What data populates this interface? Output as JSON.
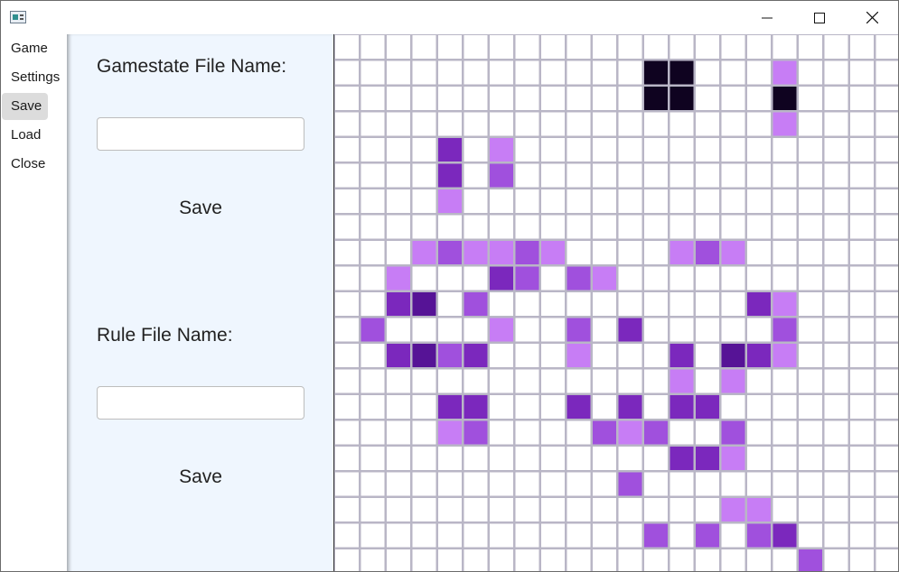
{
  "window": {
    "title": "",
    "controls": [
      "minimize",
      "maximize",
      "close"
    ]
  },
  "menu": {
    "items": [
      {
        "label": "Game",
        "selected": false
      },
      {
        "label": "Settings",
        "selected": false
      },
      {
        "label": "Save",
        "selected": true
      },
      {
        "label": "Load",
        "selected": false
      },
      {
        "label": "Close",
        "selected": false
      }
    ]
  },
  "save_panel": {
    "gamestate_label": "Gamestate File Name:",
    "gamestate_value": "",
    "gamestate_button": "Save",
    "rule_label": "Rule File Name:",
    "rule_value": "",
    "rule_button": "Save"
  },
  "grid": {
    "columns": 22,
    "rows": 21,
    "colors": {
      "0": "#ffffff",
      "1": "#c77df5",
      "2": "#a050dd",
      "3": "#7b28bd",
      "4": "#561396",
      "5": "#0f0320"
    },
    "cells": [
      [
        0,
        0,
        0,
        0,
        0,
        0,
        0,
        0,
        0,
        0,
        0,
        0,
        0,
        0,
        0,
        0,
        0,
        0,
        0,
        0,
        0,
        0
      ],
      [
        0,
        0,
        0,
        0,
        0,
        0,
        0,
        0,
        0,
        0,
        0,
        0,
        5,
        5,
        0,
        0,
        0,
        1,
        0,
        0,
        0,
        0
      ],
      [
        0,
        0,
        0,
        0,
        0,
        0,
        0,
        0,
        0,
        0,
        0,
        0,
        5,
        5,
        0,
        0,
        0,
        5,
        0,
        0,
        0,
        0
      ],
      [
        0,
        0,
        0,
        0,
        0,
        0,
        0,
        0,
        0,
        0,
        0,
        0,
        0,
        0,
        0,
        0,
        0,
        1,
        0,
        0,
        0,
        0
      ],
      [
        0,
        0,
        0,
        0,
        3,
        0,
        1,
        0,
        0,
        0,
        0,
        0,
        0,
        0,
        0,
        0,
        0,
        0,
        0,
        0,
        0,
        0
      ],
      [
        0,
        0,
        0,
        0,
        3,
        0,
        2,
        0,
        0,
        0,
        0,
        0,
        0,
        0,
        0,
        0,
        0,
        0,
        0,
        0,
        0,
        0
      ],
      [
        0,
        0,
        0,
        0,
        1,
        0,
        0,
        0,
        0,
        0,
        0,
        0,
        0,
        0,
        0,
        0,
        0,
        0,
        0,
        0,
        0,
        0
      ],
      [
        0,
        0,
        0,
        0,
        0,
        0,
        0,
        0,
        0,
        0,
        0,
        0,
        0,
        0,
        0,
        0,
        0,
        0,
        0,
        0,
        0,
        0
      ],
      [
        0,
        0,
        0,
        1,
        2,
        1,
        1,
        2,
        1,
        0,
        0,
        0,
        0,
        1,
        2,
        1,
        0,
        0,
        0,
        0,
        0,
        0
      ],
      [
        0,
        0,
        1,
        0,
        0,
        0,
        3,
        2,
        0,
        2,
        1,
        0,
        0,
        0,
        0,
        0,
        0,
        0,
        0,
        0,
        0,
        0
      ],
      [
        0,
        0,
        3,
        4,
        0,
        2,
        0,
        0,
        0,
        0,
        0,
        0,
        0,
        0,
        0,
        0,
        3,
        1,
        0,
        0,
        0,
        0
      ],
      [
        0,
        2,
        0,
        0,
        0,
        0,
        1,
        0,
        0,
        2,
        0,
        3,
        0,
        0,
        0,
        0,
        0,
        2,
        0,
        0,
        0,
        0
      ],
      [
        0,
        0,
        3,
        4,
        2,
        3,
        0,
        0,
        0,
        1,
        0,
        0,
        0,
        3,
        0,
        4,
        3,
        1,
        0,
        0,
        0,
        0
      ],
      [
        0,
        0,
        0,
        0,
        0,
        0,
        0,
        0,
        0,
        0,
        0,
        0,
        0,
        1,
        0,
        1,
        0,
        0,
        0,
        0,
        0,
        0
      ],
      [
        0,
        0,
        0,
        0,
        3,
        3,
        0,
        0,
        0,
        3,
        0,
        3,
        0,
        3,
        3,
        0,
        0,
        0,
        0,
        0,
        0,
        0
      ],
      [
        0,
        0,
        0,
        0,
        1,
        2,
        0,
        0,
        0,
        0,
        2,
        1,
        2,
        0,
        0,
        2,
        0,
        0,
        0,
        0,
        0,
        0
      ],
      [
        0,
        0,
        0,
        0,
        0,
        0,
        0,
        0,
        0,
        0,
        0,
        0,
        0,
        3,
        3,
        1,
        0,
        0,
        0,
        0,
        0,
        0
      ],
      [
        0,
        0,
        0,
        0,
        0,
        0,
        0,
        0,
        0,
        0,
        0,
        2,
        0,
        0,
        0,
        0,
        0,
        0,
        0,
        0,
        0,
        0
      ],
      [
        0,
        0,
        0,
        0,
        0,
        0,
        0,
        0,
        0,
        0,
        0,
        0,
        0,
        0,
        0,
        1,
        1,
        0,
        0,
        0,
        0,
        0
      ],
      [
        0,
        0,
        0,
        0,
        0,
        0,
        0,
        0,
        0,
        0,
        0,
        0,
        2,
        0,
        2,
        0,
        2,
        3,
        0,
        0,
        0,
        0
      ],
      [
        0,
        0,
        0,
        0,
        0,
        0,
        0,
        0,
        0,
        0,
        0,
        0,
        0,
        0,
        0,
        0,
        0,
        0,
        2,
        0,
        0,
        0
      ]
    ]
  }
}
